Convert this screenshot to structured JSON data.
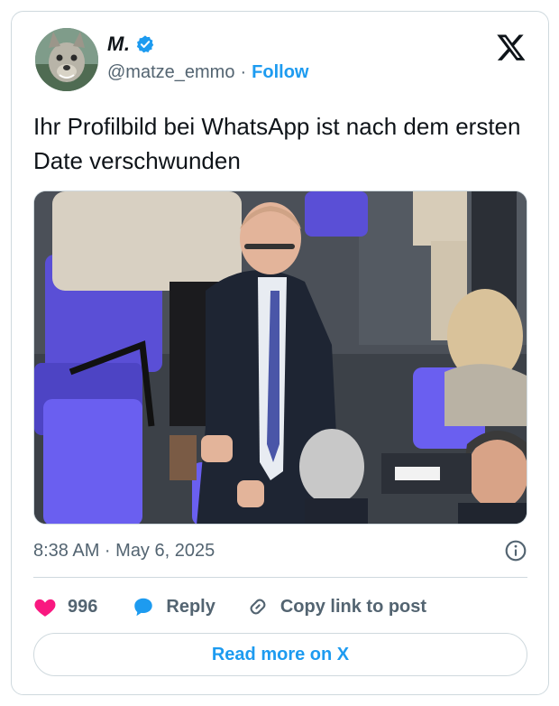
{
  "tweet": {
    "author": {
      "display_name": "M.",
      "handle": "@matze_emmo",
      "separator": "·",
      "follow_label": "Follow",
      "verified": true
    },
    "text": "Ihr Profilbild bei WhatsApp ist nach dem ersten Date verschwunden",
    "timestamp": "8:38 AM · May 6, 2025",
    "likes": "996",
    "reply_label": "Reply",
    "copy_link_label": "Copy link to post",
    "read_more_label": "Read more on X"
  },
  "colors": {
    "accent": "#1d9bf0",
    "like": "#f91880",
    "secondary_text": "#536471",
    "border": "#cfd9de"
  },
  "icons": {
    "verified": "verified-badge-icon",
    "logo": "x-logo-icon",
    "info": "info-icon",
    "like": "heart-icon",
    "reply": "reply-bubble-icon",
    "copy": "link-icon"
  }
}
